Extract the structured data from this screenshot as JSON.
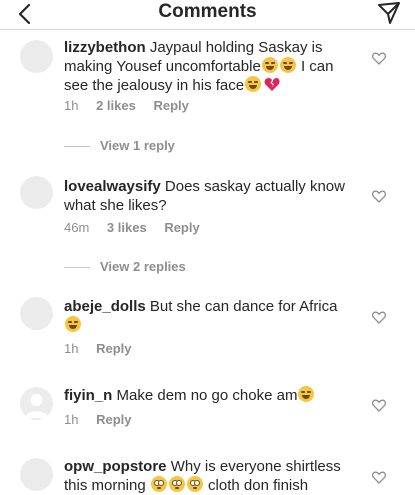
{
  "header": {
    "title": "Comments",
    "back_icon": "chevron-left-icon",
    "share_icon": "direct-send-icon"
  },
  "comments": [
    {
      "username": "lizzybethon",
      "text_1": "Jaypaul holding Saskay is making Yousef uncomfortable",
      "text_2": " I can see the jealousy in his face",
      "time": "1h",
      "likes": "2 likes",
      "reply": "Reply",
      "view_replies": "View 1 reply"
    },
    {
      "username": "lovealwaysify",
      "text_1": "Does saskay actually know what she likes?",
      "time": "46m",
      "likes": "3 likes",
      "reply": "Reply",
      "view_replies": "View 2 replies"
    },
    {
      "username": "abeje_dolls",
      "text_1": "But she can dance for Africa",
      "time": "1h",
      "reply": "Reply"
    },
    {
      "username": "fiyin_n",
      "text_1": "Make dem no go choke am",
      "time": "1h",
      "reply": "Reply"
    },
    {
      "username": "opw_popstore",
      "text_1": "Why is everyone shirtless this morning",
      "text_2": " cloth don finish"
    }
  ],
  "colors": {
    "text": "#262626",
    "secondary": "#8e8e8e",
    "divider": "#dbdbdb",
    "avatar_placeholder": "#ebebeb"
  }
}
